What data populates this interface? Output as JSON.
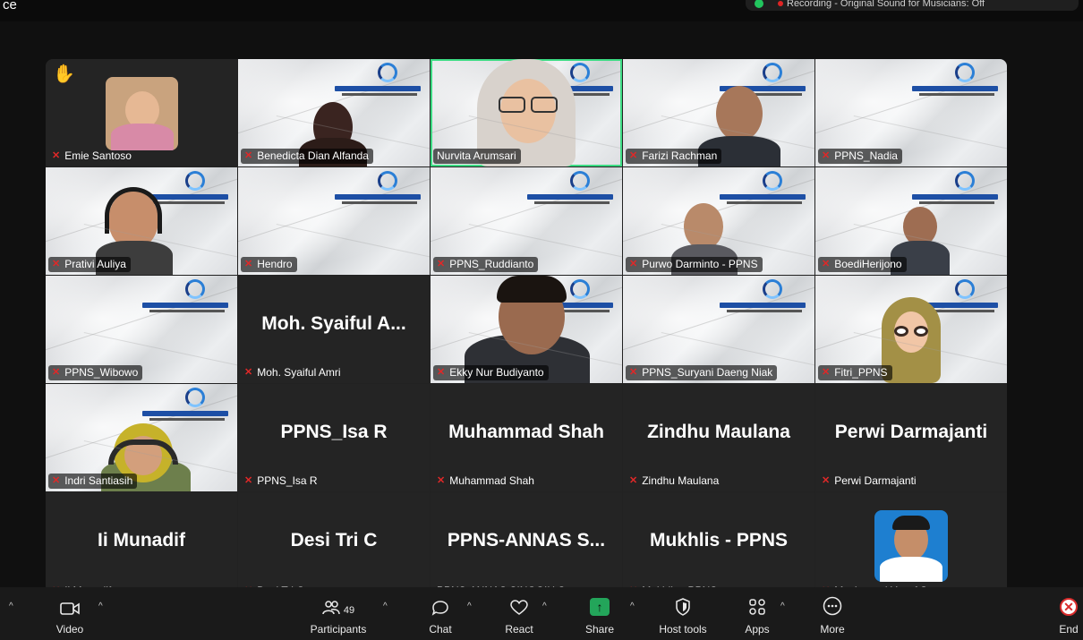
{
  "window": {
    "corner_text": "ce",
    "recording_status": "Recording - Original Sound for Musicians: Off"
  },
  "tiles": [
    {
      "name": "Emie Santoso",
      "big": ""
    },
    {
      "name": "Benedicta Dian Alfanda",
      "big": ""
    },
    {
      "name": "Nurvita Arumsari",
      "big": ""
    },
    {
      "name": "Farizi Rachman",
      "big": ""
    },
    {
      "name": "PPNS_Nadia",
      "big": ""
    },
    {
      "name": "Prativi Auliya",
      "big": ""
    },
    {
      "name": "Hendro",
      "big": ""
    },
    {
      "name": "PPNS_Ruddianto",
      "big": ""
    },
    {
      "name": "Purwo Darminto - PPNS",
      "big": ""
    },
    {
      "name": "BoediHerijono",
      "big": ""
    },
    {
      "name": "PPNS_Wibowo",
      "big": ""
    },
    {
      "name": "Moh. Syaiful Amri",
      "big": "Moh. Syaiful A..."
    },
    {
      "name": "Ekky Nur Budiyanto",
      "big": ""
    },
    {
      "name": "PPNS_Suryani Daeng Niak",
      "big": ""
    },
    {
      "name": "Fitri_PPNS",
      "big": ""
    },
    {
      "name": "Indri Santiasih",
      "big": ""
    },
    {
      "name": "PPNS_Isa R",
      "big": "PPNS_Isa R"
    },
    {
      "name": "Muhammad Shah",
      "big": "Muhammad Shah"
    },
    {
      "name": "Zindhu Maulana",
      "big": "Zindhu Maulana"
    },
    {
      "name": "Perwi Darmajanti",
      "big": "Perwi Darmajanti"
    },
    {
      "name": "Ii Munadif",
      "big": "Ii Munadif"
    },
    {
      "name": "Desi Tri C",
      "big": "Desi Tri C"
    },
    {
      "name": "PPNS-ANNAS SINGGIH S",
      "big": "PPNS-ANNAS S..."
    },
    {
      "name": "Mukhlis - PPNS",
      "big": "Mukhlis - PPNS"
    },
    {
      "name": "Mochamad Yusuf Santoso",
      "big": ""
    }
  ],
  "toolbar": {
    "video": "Video",
    "participants": "Participants",
    "participants_count": "49",
    "chat": "Chat",
    "react": "React",
    "share": "Share",
    "host_tools": "Host tools",
    "apps": "Apps",
    "more": "More",
    "end": "End"
  },
  "colors": {
    "speaker_outline": "#3ddc84",
    "mic_off": "#e02828",
    "share_green": "#23a55a",
    "end_red": "#d92c2c"
  }
}
